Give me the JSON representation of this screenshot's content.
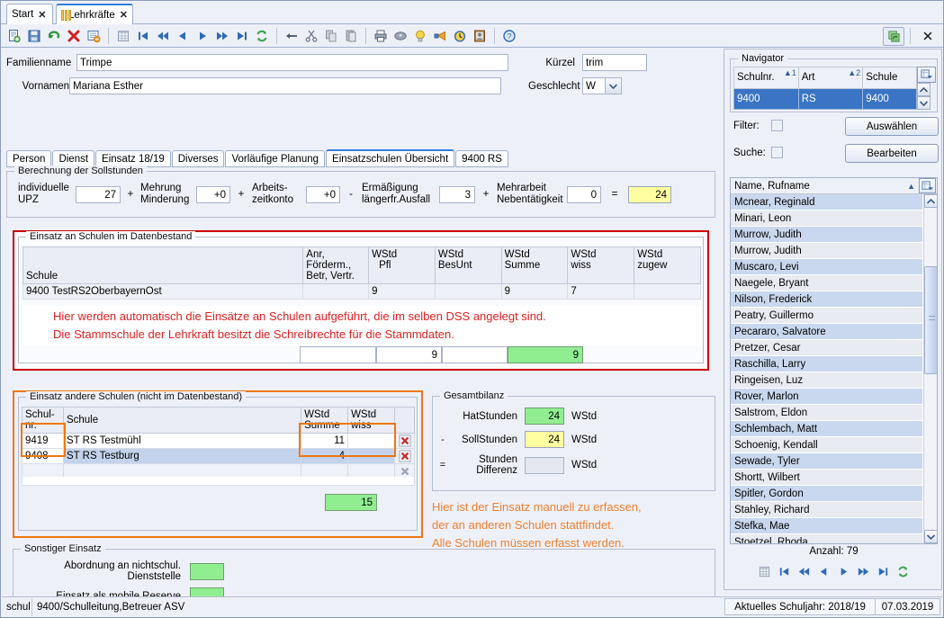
{
  "window": {
    "tabs": [
      {
        "label": "Start",
        "icon": "none",
        "active": false
      },
      {
        "label": "Lehrkräfte",
        "icon": "people-icon",
        "active": true
      }
    ],
    "close_label": "✕"
  },
  "toolbar": {
    "groups": [
      [
        "new-icon",
        "save-icon",
        "undo-icon",
        "delete-icon",
        "detail-icon"
      ],
      [
        "table-icon",
        "first-icon",
        "prev-fast-icon",
        "prev-icon",
        "next-icon",
        "next-fast-icon",
        "last-icon",
        "refresh-icon"
      ],
      [
        "back-icon",
        "cut-icon",
        "copy-icon",
        "paste-icon"
      ],
      [
        "print-icon",
        "disk-icon",
        "idea-icon",
        "megaphone-icon",
        "clock-icon",
        "user-icon"
      ],
      [
        "help-icon"
      ]
    ],
    "right": [
      "window-refresh-icon",
      "close-icon"
    ]
  },
  "person": {
    "familienname_label": "Familienname",
    "familienname_value": "Trimpe",
    "vornamen_label": "Vornamen",
    "vornamen_value": "Mariana Esther",
    "kuerzel_label": "Kürzel",
    "kuerzel_value": "trim",
    "geschlecht_label": "Geschlecht",
    "geschlecht_value": "W"
  },
  "subtabs": [
    {
      "label": "Person",
      "active": false
    },
    {
      "label": "Dienst",
      "active": false
    },
    {
      "label": "Einsatz 18/19",
      "active": false
    },
    {
      "label": "Diverses",
      "active": false
    },
    {
      "label": "Vorläufige Planung",
      "active": false
    },
    {
      "label": "Einsatzschulen Übersicht",
      "active": true
    },
    {
      "label": "9400 RS",
      "active": false
    }
  ],
  "sollstunden": {
    "title": "Berechnung der Sollstunden",
    "items": [
      {
        "op": "",
        "label1": "individuelle",
        "label2": "UPZ",
        "value": "27",
        "style": "white"
      },
      {
        "op": "+",
        "label1": "Mehrung",
        "label2": "Minderung",
        "value": "+0",
        "style": "white"
      },
      {
        "op": "+",
        "label1": "Arbeits-",
        "label2": "zeitkonto",
        "value": "+0",
        "style": "white"
      },
      {
        "op": "-",
        "label1": "Ermäßigung",
        "label2": "längerfr.Ausfall",
        "value": "3",
        "style": "white"
      },
      {
        "op": "+",
        "label1": "Mehrarbeit",
        "label2": "Nebentätigkeit",
        "value": "0",
        "style": "white"
      },
      {
        "op": "=",
        "label1": "",
        "label2": "",
        "value": "24",
        "style": "yellow"
      }
    ]
  },
  "einsatz_datenbestand": {
    "title": "Einsatz an Schulen im Datenbestand",
    "columns": [
      {
        "l1": "Schule",
        "l2": ""
      },
      {
        "l1": "Anr, Förderm.,",
        "l2": "Betr, Vertr."
      },
      {
        "l1": "WStd",
        "l2": "Pfl"
      },
      {
        "l1": "WStd",
        "l2": "BesUnt"
      },
      {
        "l1": "WStd",
        "l2": "Summe"
      },
      {
        "l1": "WStd",
        "l2": "wiss"
      },
      {
        "l1": "WStd",
        "l2": "zugew"
      }
    ],
    "rows": [
      [
        "9400 TestRS2OberbayernOst",
        "",
        "9",
        "",
        "9",
        "7",
        ""
      ]
    ],
    "totals": [
      "",
      "9",
      "",
      "9"
    ],
    "annotation": [
      "Hier werden automatisch die Einsätze an Schulen aufgeführt, die im selben DSS angelegt sind.",
      "Die Stammschule der Lehrkraft besitzt die Schreibrechte für die Stammdaten."
    ]
  },
  "einsatz_andere": {
    "title": "Einsatz andere Schulen (nicht im Datenbestand)",
    "columns": [
      {
        "l1": "Schul-",
        "l2": "nr."
      },
      {
        "l1": "Schule",
        "l2": ""
      },
      {
        "l1": "WStd",
        "l2": "Summe"
      },
      {
        "l1": "WStd",
        "l2": "wiss"
      },
      {
        "l1": "",
        "l2": ""
      }
    ],
    "rows": [
      {
        "nr": "9419",
        "schule": "ST RS Testmühl",
        "summe": "11",
        "wiss": "",
        "selected": false
      },
      {
        "nr": "9408",
        "schule": "ST RS Testburg",
        "summe": "4",
        "wiss": "",
        "selected": true
      }
    ],
    "total": "15",
    "annotation": [
      "Hier ist der Einsatz manuell zu erfassen,",
      "der an anderen Schulen stattfindet.",
      "Alle Schulen müssen erfasst werden."
    ]
  },
  "gesamtbilanz": {
    "title": "Gesamtbilanz",
    "rows": [
      {
        "op": "",
        "label1": "HatStunden",
        "label2": "",
        "value": "24",
        "unit": "WStd",
        "style": "green"
      },
      {
        "op": "-",
        "label1": "SollStunden",
        "label2": "",
        "value": "24",
        "unit": "WStd",
        "style": "yellow"
      },
      {
        "op": "=",
        "label1": "Stunden",
        "label2": "Differenz",
        "value": "",
        "unit": "WStd",
        "style": "gray"
      }
    ]
  },
  "sonstiger": {
    "title": "Sonstiger Einsatz",
    "rows": [
      {
        "label": "Abordnung an nichtschul. Dienststelle",
        "value": "",
        "style": "green"
      },
      {
        "label": "Einsatz als mobile Reserve",
        "value": "",
        "style": "green"
      }
    ]
  },
  "navigator": {
    "title": "Navigator",
    "columns": [
      {
        "label": "Schulnr.",
        "sort": "▲1"
      },
      {
        "label": "Art",
        "sort": "▲2"
      },
      {
        "label": "Schule",
        "sort": ""
      }
    ],
    "rows": [
      [
        "9400",
        "RS",
        "9400"
      ]
    ],
    "filter_label": "Filter:",
    "suche_label": "Suche:",
    "auswaehlen_label": "Auswählen",
    "bearbeiten_label": "Bearbeiten",
    "list_header": "Name, Rufname",
    "list_items": [
      "Mcnear, Reginald",
      "Minari, Leon",
      "Murrow, Judith",
      "Murrow, Judith",
      "Muscaro, Levi",
      "Naegele, Bryant",
      "Nilson, Frederick",
      "Peatry, Guillermo",
      "Pecararo, Salvatore",
      "Pretzer, Cesar",
      "Raschilla, Larry",
      "Ringeisen, Luz",
      "Rover, Marlon",
      "Salstrom, Eldon",
      "Schlembach, Matt",
      "Schoenig, Kendall",
      "Sewade, Tyler",
      "Shortt, Wilbert",
      "Spitler, Gordon",
      "Stahley, Richard",
      "Stefka, Mae",
      "Stoetzel, Rhoda"
    ],
    "count_label": "Anzahl: 79",
    "nav_buttons": [
      "table-icon",
      "first-icon",
      "prev-fast-icon",
      "prev-icon",
      "next-icon",
      "next-fast-icon",
      "last-icon",
      "refresh-icon"
    ]
  },
  "statusbar": {
    "user": "schul",
    "context": "9400/Schulleitung,Betreuer ASV",
    "schuljahr": "Aktuelles Schuljahr: 2018/19",
    "date": "07.03.2019"
  },
  "colors": {
    "accent_blue": "#3b74c4",
    "red_annotation": "#e02020",
    "orange_annotation": "#ee7f2d",
    "green_field": "#90ee90",
    "yellow_field": "#ffffa0"
  }
}
